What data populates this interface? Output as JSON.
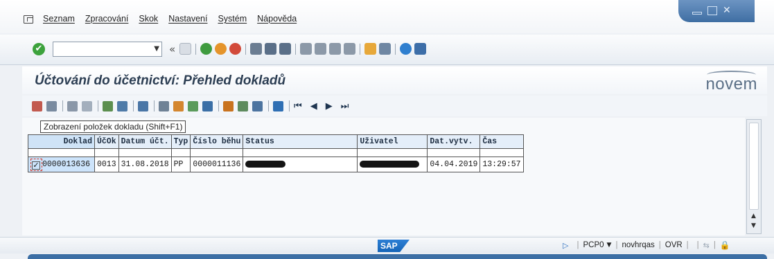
{
  "menu": {
    "items": [
      "Seznam",
      "Zpracování",
      "Skok",
      "Nastavení",
      "Systém",
      "Nápověda"
    ]
  },
  "toolbar": {
    "command_value": ""
  },
  "screen": {
    "title": "Účtování do účetnictví: Přehled dokladů",
    "logo": "novem"
  },
  "tooltip": "Zobrazení položek dokladu   (Shift+F1)",
  "table": {
    "columns": [
      "Doklad",
      "ÚčOk",
      "Datum účt.",
      "Typ",
      "Číslo běhu",
      "Status",
      "Uživatel",
      "Dat.vytv.",
      "Čas"
    ],
    "rows": [
      {
        "checked": true,
        "doklad": "0000013636",
        "ucok": "0013",
        "datum": "31.08.2018",
        "typ": "PP",
        "cislo_behu": "0000011136",
        "status": "",
        "uzivatel": "",
        "dat_vytv": "04.04.2019",
        "cas": "13:29:57"
      }
    ]
  },
  "statusbar": {
    "sap_logo": "SAP",
    "system": "PCP0",
    "user": "novhrqas",
    "mode": "OVR"
  },
  "colors": {
    "accent": "#3f6ea3",
    "ok_green": "#3ca23c",
    "selection": "#cde4fb"
  }
}
